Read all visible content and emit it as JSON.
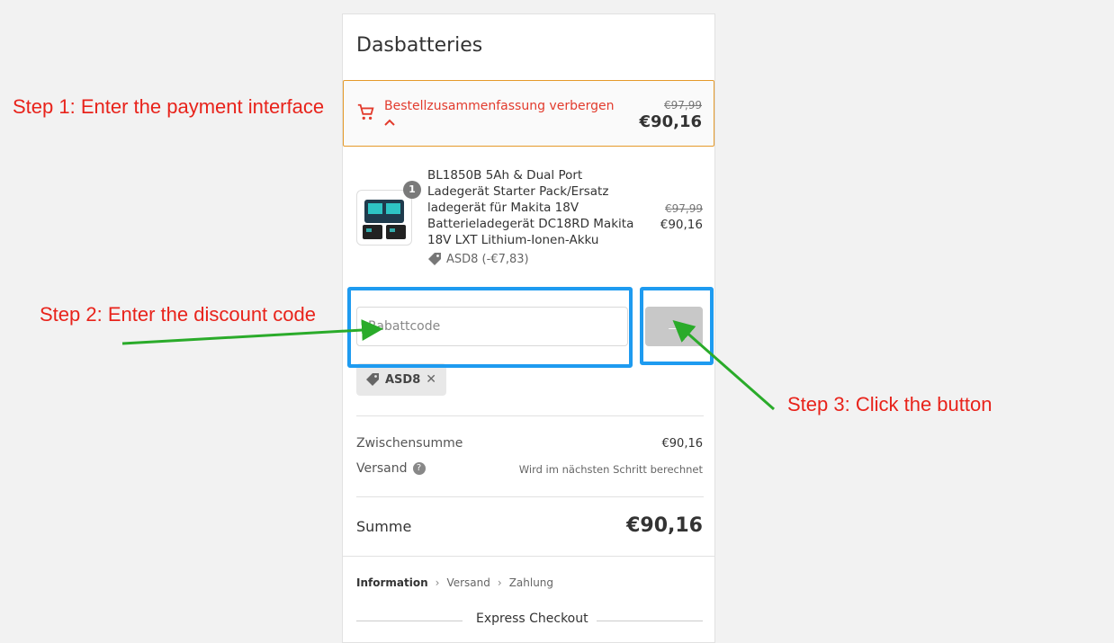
{
  "shop": {
    "title": "Dasbatteries"
  },
  "summary_toggle": {
    "label": "Bestellzusammenfassung verbergen",
    "compare_price": "€97,99",
    "price": "€90,16"
  },
  "product": {
    "quantity": "1",
    "name": "BL1850B 5Ah & Dual Port Ladegerät Starter Pack/Ersatz ladegerät für Makita 18V Batterieladegerät DC18RD Makita 18V LXT Lithium-Ionen-Akku",
    "discount": "ASD8 (-€7,83)",
    "compare_price": "€97,99",
    "price": "€90,16"
  },
  "discount_form": {
    "placeholder": "Rabattcode",
    "apply_label": "→",
    "applied_code": "ASD8",
    "remove_label": "✕"
  },
  "totals": {
    "subtotal_label": "Zwischensumme",
    "subtotal_value": "€90,16",
    "shipping_label": "Versand",
    "shipping_help": "?",
    "shipping_value": "Wird im nächsten Schritt berechnet",
    "total_label": "Summe",
    "total_value": "€90,16"
  },
  "breadcrumb": {
    "items": [
      "Information",
      "Versand",
      "Zahlung"
    ],
    "separator": "›"
  },
  "express": {
    "label": "Express Checkout"
  },
  "annotations": {
    "step1": "Step 1: Enter the payment interface",
    "step2": "Step 2: Enter the discount code",
    "step3": "Step 3: Click the button"
  },
  "colors": {
    "annotation_text": "#e8231b",
    "highlight_box": "#1e9bf0",
    "arrow": "#2aab2a",
    "toggle_border": "#e59a2b",
    "toggle_text": "#e23b2d"
  },
  "icons": [
    "cart-icon",
    "chevron-up-icon",
    "tag-icon",
    "close-icon",
    "arrow-right-icon",
    "help-icon",
    "chevron-right-icon"
  ]
}
